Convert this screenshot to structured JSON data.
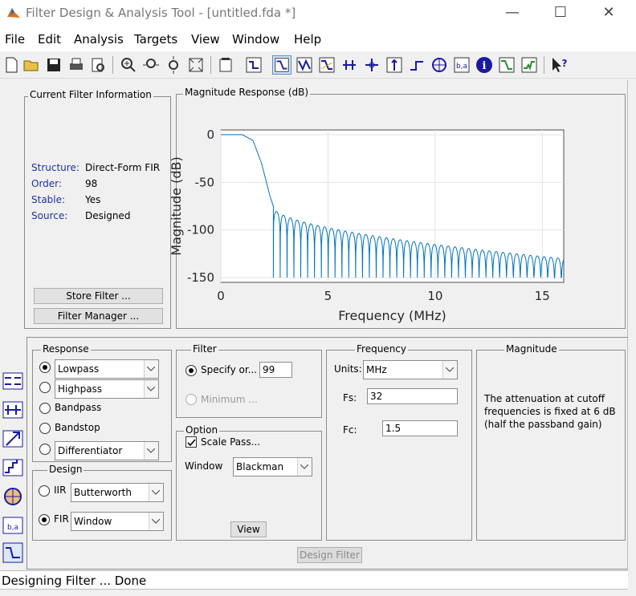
{
  "window": {
    "title": "Filter Design & Analysis Tool -  [untitled.fda *]",
    "minimize": "—",
    "maximize": "☐",
    "close": "✕"
  },
  "menu": [
    "File",
    "Edit",
    "Analysis",
    "Targets",
    "View",
    "Window",
    "Help"
  ],
  "toolbar_icons": [
    "new-icon",
    "open-icon",
    "save-icon",
    "print-icon",
    "print-preview-icon",
    "zoom-in-icon",
    "zoom-x-icon",
    "zoom-y-icon",
    "full-view-icon",
    "new-figure-icon",
    "filter-specs-icon",
    "magnitude-response-icon",
    "phase-response-icon",
    "magnitude-phase-icon",
    "group-delay-icon",
    "phase-delay-icon",
    "impulse-response-icon",
    "step-response-icon",
    "pole-zero-icon",
    "filter-coefficients-icon",
    "filter-info-icon",
    "magnitude-estimate-icon",
    "round-off-noise-icon",
    "whats-this-icon"
  ],
  "current_filter_info": {
    "title": "Current Filter Information",
    "rows": [
      {
        "label": "Structure:",
        "value": "Direct-Form FIR"
      },
      {
        "label": "Order:",
        "value": "98"
      },
      {
        "label": "Stable:",
        "value": "Yes"
      },
      {
        "label": "Source:",
        "value": "Designed"
      }
    ],
    "store_button": "Store Filter ...",
    "manager_button": "Filter Manager ..."
  },
  "plot": {
    "title": "Magnitude Response (dB)",
    "chart_data": {
      "type": "line",
      "xlabel": "Frequency (MHz)",
      "ylabel": "Magnitude (dB)",
      "xlim": [
        0,
        16
      ],
      "ylim": [
        -155,
        5
      ],
      "xticks": [
        "0",
        "5",
        "10",
        "15"
      ],
      "yticks": [
        "0",
        "-50",
        "-100",
        "-150"
      ],
      "grid": true,
      "series": [
        {
          "color": "#0072bd",
          "passband": [
            [
              0,
              0
            ],
            [
              1.0,
              0
            ],
            [
              1.5,
              -6
            ],
            [
              1.9,
              -30
            ],
            [
              2.3,
              -65
            ],
            [
              2.45,
              -75
            ]
          ],
          "stopband": {
            "first_peak_db": -76,
            "last_peak_db": -130,
            "null_db": -150,
            "lobe_width_mhz": 0.32,
            "end": 16
          }
        }
      ]
    }
  },
  "response_type": {
    "title": "Response",
    "lowpass": {
      "label": "Lowpass",
      "selected": true
    },
    "highpass": {
      "label": "Highpass"
    },
    "bandpass": {
      "label": "Bandpass"
    },
    "bandstop": {
      "label": "Bandstop"
    },
    "differentiator": {
      "label": "Differentiator"
    }
  },
  "design_method": {
    "title": "Design",
    "iir": {
      "label": "IIR",
      "value": "Butterworth"
    },
    "fir": {
      "label": "FIR",
      "value": "Window",
      "selected": true
    }
  },
  "filter_order": {
    "title": "Filter",
    "specify_label": "Specify or...",
    "specify_value": "99",
    "minimum_label": "Minimum ..."
  },
  "options": {
    "title": "Option",
    "scale_label": "Scale Pass...",
    "scale_checked": true,
    "window_label": "Window",
    "window_value": "Blackman",
    "view_button": "View"
  },
  "frequency": {
    "title": "Frequency",
    "units_label": "Units:",
    "units_value": "MHz",
    "fs_label": "Fs:",
    "fs_value": "32",
    "fc_label": "Fc:",
    "fc_value": "1.5"
  },
  "magnitude": {
    "title": "Magnitude",
    "text": "The attenuation at cutoff frequencies is fixed at 6 dB (half the passband gain)"
  },
  "design_button": "Design Filter",
  "status": "Designing Filter ... Done"
}
